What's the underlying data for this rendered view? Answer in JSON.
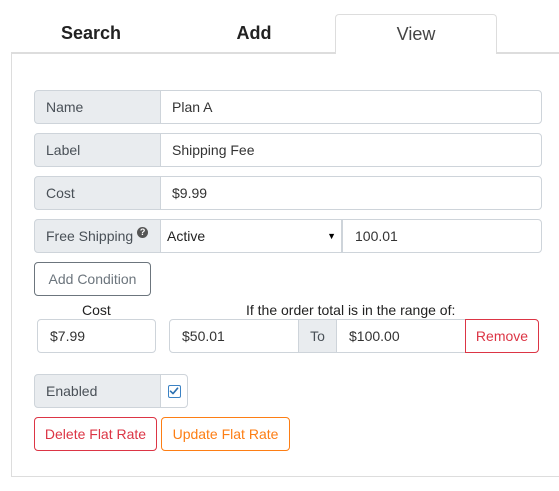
{
  "tabs": {
    "search": "Search",
    "add": "Add",
    "view": "View"
  },
  "form": {
    "name": {
      "label": "Name",
      "value": "Plan A"
    },
    "label": {
      "label": "Label",
      "value": "Shipping Fee"
    },
    "cost": {
      "label": "Cost",
      "value": "$9.99"
    },
    "free_shipping": {
      "label": "Free Shipping",
      "help_icon": "question-circle-icon",
      "selected": "Active",
      "threshold": "100.01"
    },
    "add_condition": "Add Condition",
    "conditions": {
      "cost_header": "Cost",
      "range_header": "If the order total is in the range of:",
      "to_label": "To",
      "remove": "Remove",
      "rows": [
        {
          "cost": "$7.99",
          "from": "$50.01",
          "to": "$100.00"
        }
      ]
    },
    "enabled": {
      "label": "Enabled",
      "checked": true
    },
    "delete": "Delete Flat Rate",
    "update": "Update Flat Rate"
  },
  "colors": {
    "danger": "#dc3545",
    "warning": "#fd7e14",
    "secondary": "#6c757d",
    "addon_bg": "#e9ecef"
  }
}
